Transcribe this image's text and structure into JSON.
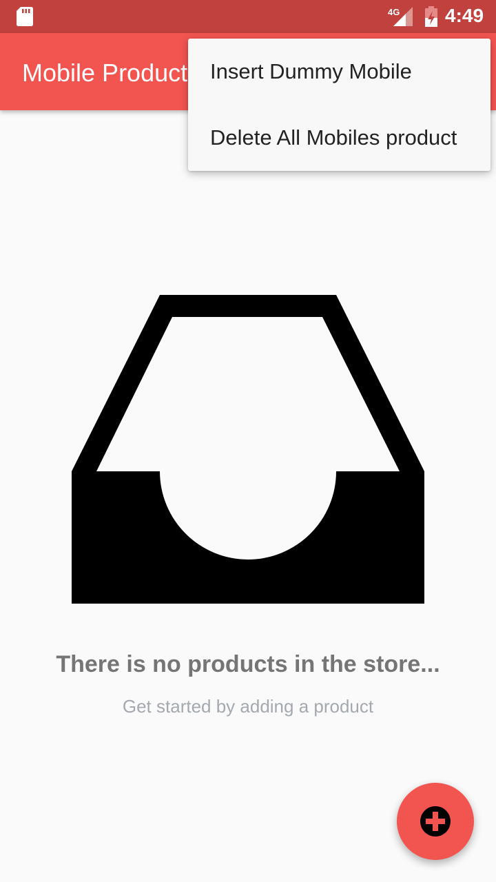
{
  "status_bar": {
    "time": "4:49",
    "network": "4G",
    "icons": [
      "sd-card-icon",
      "signal-icon",
      "battery-icon"
    ]
  },
  "app_bar": {
    "title": "Mobile Products"
  },
  "overflow_menu": {
    "items": [
      {
        "label": "Insert Dummy Mobile"
      },
      {
        "label": "Delete All Mobiles product"
      }
    ]
  },
  "empty_state": {
    "icon": "inbox-icon",
    "title": "There is no products in the store...",
    "subtitle": "Get started by adding a product"
  },
  "fab": {
    "icon": "add-icon"
  },
  "colors": {
    "status_bar": "#c0413d",
    "primary": "#f25450",
    "background": "#fafafa",
    "title_text": "#757575",
    "subtitle_text": "#a4a9af"
  }
}
